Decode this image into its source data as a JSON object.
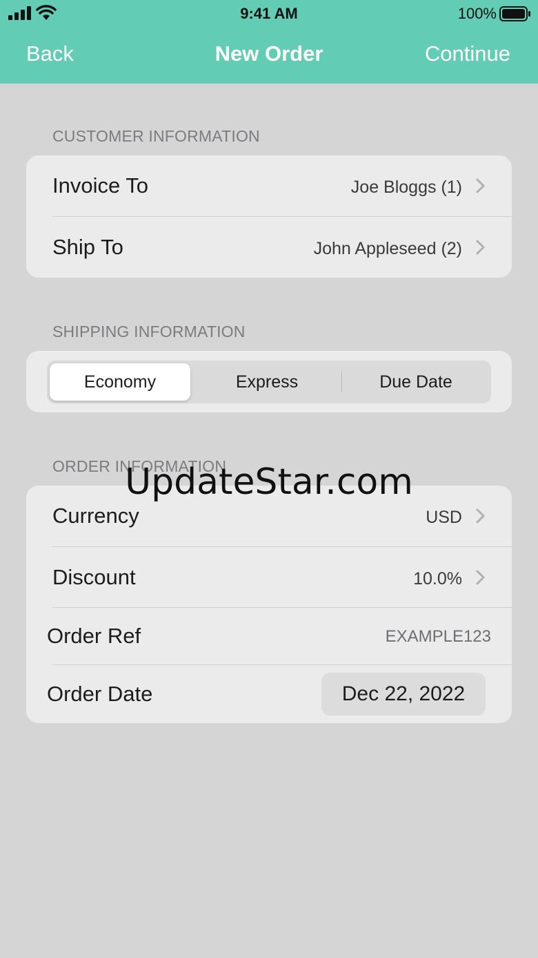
{
  "status_bar": {
    "time": "9:41 AM",
    "battery_percent": "100%",
    "icons": [
      "cellular-signal-icon",
      "wifi-icon",
      "battery-icon"
    ]
  },
  "nav": {
    "back_label": "Back",
    "title": "New Order",
    "continue_label": "Continue"
  },
  "colors": {
    "accent": "#63ccb5",
    "background": "#d5d5d5",
    "card": "#ebebeb"
  },
  "customer": {
    "header": "CUSTOMER INFORMATION",
    "invoice_to_label": "Invoice To",
    "invoice_to_value": "Joe Bloggs (1)",
    "ship_to_label": "Ship To",
    "ship_to_value": "John Appleseed (2)"
  },
  "shipping": {
    "header": "SHIPPING INFORMATION",
    "options": [
      "Economy",
      "Express",
      "Due Date"
    ],
    "selected": "Economy"
  },
  "order": {
    "header": "ORDER INFORMATION",
    "currency_label": "Currency",
    "currency_value": "USD",
    "discount_label": "Discount",
    "discount_value": "10.0%",
    "ref_label": "Order Ref",
    "ref_value": "EXAMPLE123",
    "date_label": "Order Date",
    "date_value": "Dec 22, 2022"
  },
  "watermark": "UpdateStar.com"
}
